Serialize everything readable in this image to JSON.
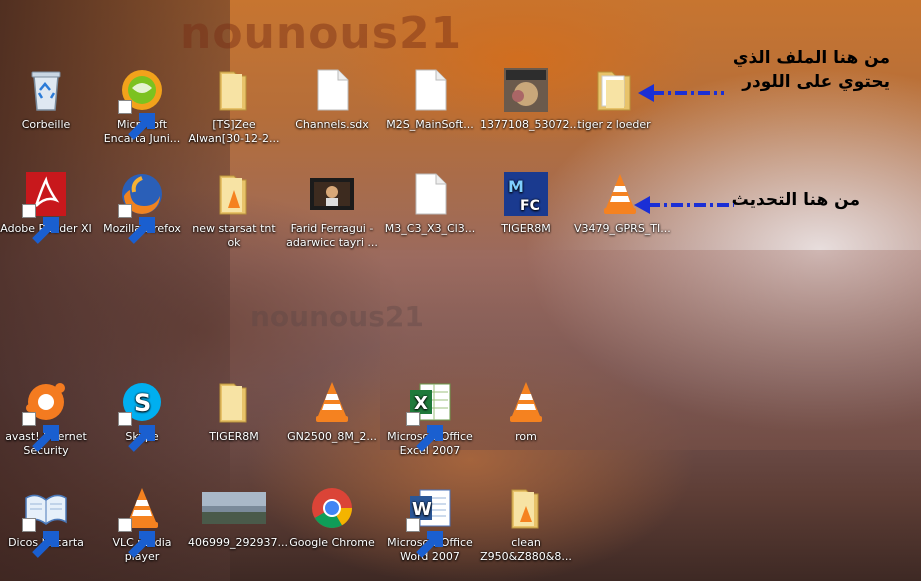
{
  "watermark": "nounous21",
  "icons": [
    {
      "label": "Corbeille",
      "icon": "recycle-bin-icon"
    },
    {
      "label": "Microsoft Encarta Juni...",
      "icon": "encarta-icon"
    },
    {
      "label": "[TS]Zee Alwan[30-12-2...",
      "icon": "folder-icon"
    },
    {
      "label": "Channels.sdx",
      "icon": "file-icon"
    },
    {
      "label": "M2S_MainSoft...",
      "icon": "file-icon"
    },
    {
      "label": "1377108_53072...",
      "icon": "image-thumbnail-icon"
    },
    {
      "label": "tiger z loeder",
      "icon": "folder-icon"
    },
    {
      "label": "Adobe Reader XI",
      "icon": "adobe-reader-icon"
    },
    {
      "label": "Mozilla Firefox",
      "icon": "firefox-icon"
    },
    {
      "label": "new starsat tnt ok",
      "icon": "folder-icon"
    },
    {
      "label": "Farid Ferragui - adarwicc tayri ...",
      "icon": "video-thumbnail-icon"
    },
    {
      "label": "M3_C3_X3_Cl3...",
      "icon": "file-icon"
    },
    {
      "label": "TIGER8M",
      "icon": "tiger8m-app-icon"
    },
    {
      "label": "V3479_GPRS_TI...",
      "icon": "vlc-icon"
    },
    {
      "label": "avast! Internet Security",
      "icon": "avast-icon"
    },
    {
      "label": "Skype",
      "icon": "skype-icon"
    },
    {
      "label": "TIGER8M",
      "icon": "folder-icon"
    },
    {
      "label": "GN2500_8M_2...",
      "icon": "vlc-icon"
    },
    {
      "label": "Microsoft Office Excel 2007",
      "icon": "excel-icon"
    },
    {
      "label": "rom",
      "icon": "vlc-icon"
    },
    {
      "label": "Dicos Encarta",
      "icon": "dictionary-icon"
    },
    {
      "label": "VLC media player",
      "icon": "vlc-icon"
    },
    {
      "label": "406999_292937...",
      "icon": "image-thumbnail-icon"
    },
    {
      "label": "Google Chrome",
      "icon": "chrome-icon"
    },
    {
      "label": "Microsoft Office Word 2007",
      "icon": "word-icon"
    },
    {
      "label": "clean Z950&Z880&8...",
      "icon": "folder-icon"
    }
  ],
  "annotations": {
    "loader_note": "من هنا الملف الذي يحتوي على اللودر",
    "update_note": "من هنا التحديث"
  },
  "colors": {
    "arrow": "#1a2fd6",
    "note_text": "#000000"
  }
}
